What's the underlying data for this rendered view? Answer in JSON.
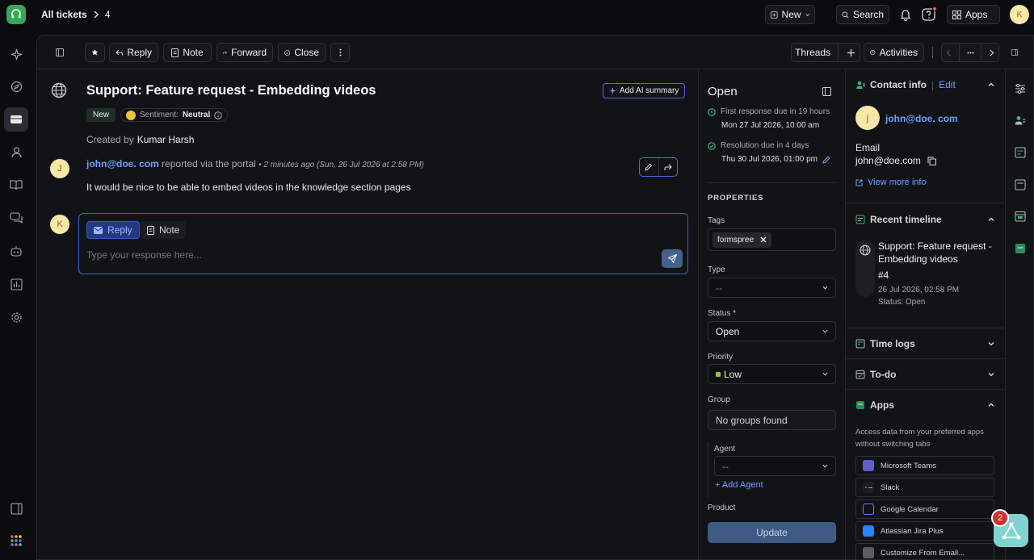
{
  "topbar": {
    "breadcrumb_all": "All tickets",
    "breadcrumb_id": "4",
    "new_label": "New",
    "search_label": "Search",
    "apps_label": "Apps",
    "user_initial": "K"
  },
  "actions": {
    "reply": "Reply",
    "note": "Note",
    "forward": "Forward",
    "close": "Close",
    "threads": "Threads",
    "activities": "Activities"
  },
  "ticket": {
    "title": "Support: Feature request - Embedding videos",
    "ai_summary": "Add AI summary",
    "status_badge": "New",
    "sentiment_label": "Sentiment:",
    "sentiment_value": "Neutral",
    "created_by_label": "Created by",
    "created_by": "Kumar Harsh",
    "reporter_initial": "J",
    "reporter_email": "john@doe. com",
    "reported_via": "reported via the portal",
    "reported_time": "• 2 minutes ago (Sun, 26 Jul 2026 at 2:58 PM)",
    "message": "It would be nice to be able to embed videos in the knowledge section pages"
  },
  "composer": {
    "avatar_initial": "K",
    "reply_tab": "Reply",
    "note_tab": "Note",
    "placeholder": "Type your response here..."
  },
  "properties": {
    "status_title": "Open",
    "first_response_label": "First response due in 19 hours",
    "first_response_date": "Mon 27 Jul 2026, 10:00 am",
    "resolution_label": "Resolution due in 4 days",
    "resolution_date": "Thu 30 Jul 2026, 01:00 pm",
    "heading": "PROPERTIES",
    "tags_label": "Tags",
    "tag": "formspree",
    "type_label": "Type",
    "type_value": "--",
    "status_label": "Status",
    "status_required": "*",
    "status_value": "Open",
    "priority_label": "Priority",
    "priority_value": "Low",
    "priority_color": "#8bc34a",
    "group_label": "Group",
    "group_value": "No groups found",
    "agent_label": "Agent",
    "agent_value": "--",
    "add_agent": "+ Add Agent",
    "product_label": "Product",
    "update_button": "Update"
  },
  "contact": {
    "header": "Contact info",
    "edit": "Edit",
    "avatar_initial": "j",
    "name": "john@doe. com",
    "email_label": "Email",
    "email_value": "john@doe.com",
    "view_more": "View more info",
    "timeline_header": "Recent timeline",
    "timeline_title": "Support: Feature request - Embedding videos",
    "timeline_id": "#4",
    "timeline_date": "26 Jul 2026, 02:58 PM",
    "timeline_status": "Status: Open",
    "time_logs": "Time logs",
    "todo": "To-do",
    "apps_header": "Apps",
    "apps_desc": "Access data from your preferred apps without switching tabs",
    "apps": [
      {
        "name": "Microsoft Teams",
        "color": "#5b5fc7"
      },
      {
        "name": "Slack",
        "color": "#1b1d21"
      },
      {
        "name": "Google Calendar",
        "color": "#2f6fd0"
      },
      {
        "name": "Atlassian Jira Plus",
        "color": "#2684ff"
      },
      {
        "name": "Customize From Email...",
        "color": "#5a5d63"
      }
    ]
  },
  "fab": {
    "badge": "2"
  }
}
